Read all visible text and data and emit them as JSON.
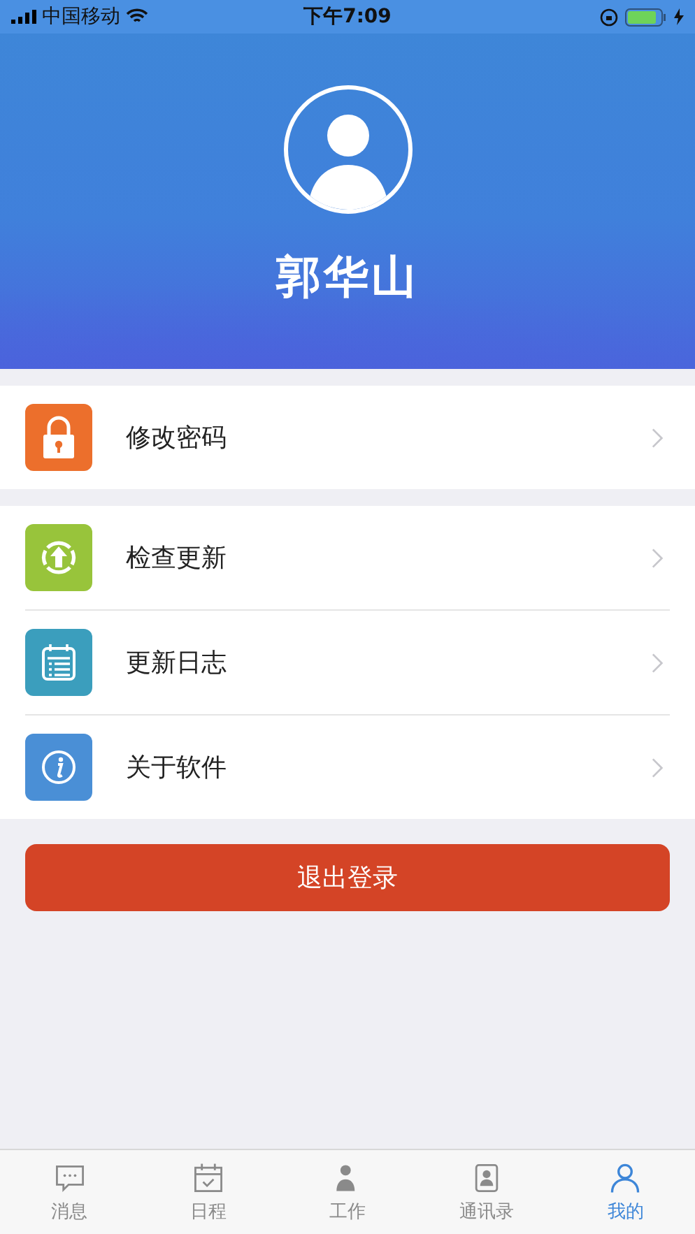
{
  "status_bar": {
    "carrier": "中国移动",
    "time": "下午7:09"
  },
  "profile": {
    "name": "郭华山"
  },
  "menu_groups": [
    {
      "items": [
        {
          "kind": "lock",
          "label": "修改密码"
        }
      ]
    },
    {
      "items": [
        {
          "kind": "update",
          "label": "检查更新"
        },
        {
          "kind": "log",
          "label": "更新日志"
        },
        {
          "kind": "info",
          "label": "关于软件"
        }
      ]
    }
  ],
  "logout_button": "退出登录",
  "tab_bar": [
    {
      "kind": "chat",
      "label": "消息",
      "selected": false
    },
    {
      "kind": "calendar",
      "label": "日程",
      "selected": false
    },
    {
      "kind": "work",
      "label": "工作",
      "selected": false
    },
    {
      "kind": "contacts",
      "label": "通讯录",
      "selected": false
    },
    {
      "kind": "me",
      "label": "我的",
      "selected": true
    }
  ]
}
